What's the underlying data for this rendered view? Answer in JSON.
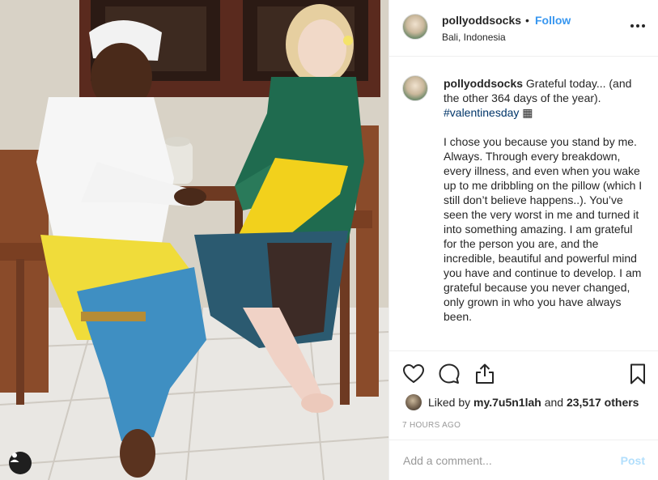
{
  "post": {
    "image_alt": "Couple in traditional Balinese clothing sitting on wooden chairs",
    "user_tag_icon": "user-tag-icon"
  },
  "header": {
    "username": "pollyoddsocks",
    "separator": "•",
    "follow_label": "Follow",
    "location": "Bali, Indonesia",
    "more_icon": "more-options-icon",
    "accent_color": "#3897f0"
  },
  "caption": {
    "username": "pollyoddsocks",
    "first_line": "Grateful today... (and the other 364 days of the year).",
    "hashtag": "#valentinesday",
    "trailing_glyph": "▦",
    "paragraph": "I chose you because you stand by me. Always. Through every breakdown, every illness, and even when you wake up to me dribbling on the pillow (which I still don’t believe happens..). You’ve seen the very worst in me and turned it into something amazing. I am grateful for the person you are, and the incredible, beautiful and powerful mind you have and continue to develop. I am grateful because you never changed, only grown in who you have always been."
  },
  "actions": {
    "like_icon": "heart-icon",
    "comment_icon": "comment-icon",
    "share_icon": "share-icon",
    "save_icon": "bookmark-icon"
  },
  "likes": {
    "prefix": "Liked by",
    "liker": "my.7u5n1lah",
    "conjunction": "and",
    "others": "23,517 others"
  },
  "timestamp": "7 HOURS AGO",
  "comment": {
    "placeholder": "Add a comment...",
    "post_label": "Post",
    "post_color": "#b2dffc"
  }
}
